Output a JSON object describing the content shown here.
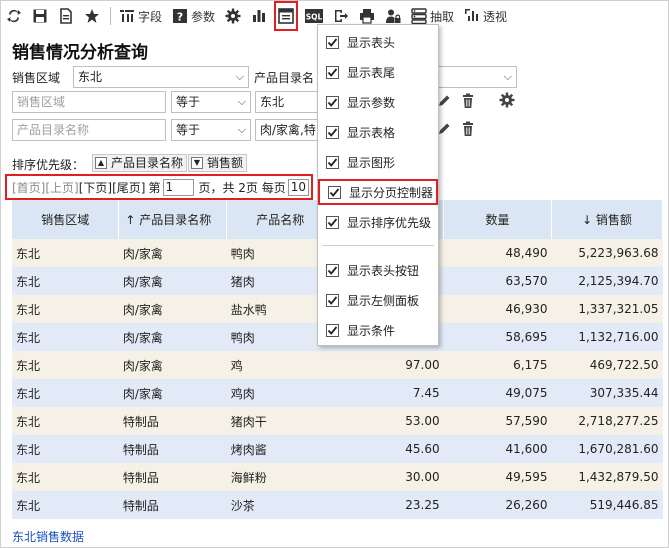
{
  "toolbar": {
    "items": [
      {
        "icon": "refresh-icon",
        "label": ""
      },
      {
        "icon": "save-icon",
        "label": ""
      },
      {
        "icon": "export-doc-icon",
        "label": ""
      },
      {
        "icon": "star-icon",
        "label": ""
      },
      {
        "icon": "fields-icon",
        "label": "字段"
      },
      {
        "icon": "param-icon",
        "label": "参数"
      },
      {
        "icon": "gear-icon",
        "label": ""
      },
      {
        "icon": "chart-icon",
        "label": ""
      },
      {
        "icon": "layout-icon",
        "label": ""
      },
      {
        "icon": "sql-icon",
        "label": "SQL"
      },
      {
        "icon": "exit-icon",
        "label": ""
      },
      {
        "icon": "print-icon",
        "label": ""
      },
      {
        "icon": "user-lock-icon",
        "label": ""
      },
      {
        "icon": "extract-icon",
        "label": "抽取"
      },
      {
        "icon": "pivot-icon",
        "label": "透视"
      }
    ]
  },
  "page_title": "销售情况分析查询",
  "filters": {
    "region_label": "销售区域",
    "region_value": "东北",
    "catalog_label": "产品目录名",
    "row1": {
      "field": "销售区域",
      "op": "等于",
      "value": "东北"
    },
    "row2": {
      "field": "产品目录名称",
      "op": "等于",
      "value": "肉/家禽,特"
    }
  },
  "sort": {
    "label": "排序优先级：",
    "chips": [
      {
        "arrow": "▲",
        "label": "产品目录名称"
      },
      {
        "arrow": "▼",
        "label": "销售额"
      }
    ]
  },
  "pager": {
    "first": "[首页]",
    "prev": "[上页]",
    "next": "[下页]",
    "last": "[尾页]",
    "page_prefix": "第",
    "page_value": "1",
    "page_suffix": "页，共 2页 每页",
    "size_value": "10"
  },
  "table": {
    "headers": [
      "销售区域",
      "↑ 产品目录名称",
      "产品名称",
      "",
      "数量",
      "↓ 销售额"
    ],
    "rows": [
      [
        "东北",
        "肉/家禽",
        "鸭肉",
        "",
        "48,490",
        "5,223,963.68"
      ],
      [
        "东北",
        "肉/家禽",
        "猪肉",
        "",
        "63,570",
        "2,125,394.70"
      ],
      [
        "东北",
        "肉/家禽",
        "盐水鸭",
        "",
        "46,930",
        "1,337,321.05"
      ],
      [
        "东北",
        "肉/家禽",
        "鸭肉",
        "",
        "58,695",
        "1,132,716.00"
      ],
      [
        "东北",
        "肉/家禽",
        "鸡",
        "97.00",
        "6,175",
        "469,722.50"
      ],
      [
        "东北",
        "肉/家禽",
        "鸡肉",
        "7.45",
        "49,075",
        "307,335.44"
      ],
      [
        "东北",
        "特制品",
        "猪肉干",
        "53.00",
        "57,590",
        "2,718,277.25"
      ],
      [
        "东北",
        "特制品",
        "烤肉酱",
        "45.60",
        "41,600",
        "1,670,281.60"
      ],
      [
        "东北",
        "特制品",
        "海鲜粉",
        "30.00",
        "49,595",
        "1,432,879.50"
      ],
      [
        "东北",
        "特制品",
        "沙茶",
        "23.25",
        "26,260",
        "519,446.85"
      ]
    ]
  },
  "footer_link": "东北销售数据",
  "menu": {
    "items": [
      "显示表头",
      "显示表尾",
      "显示参数",
      "显示表格",
      "显示图形",
      "显示分页控制器",
      "显示排序优先级",
      "显示表头按钮",
      "显示左侧面板",
      "显示条件"
    ]
  },
  "colors": {
    "header_bg": "#dbe6f4",
    "row_odd": "#f5f1e6",
    "row_even": "#e3eaf7",
    "highlight": "#e02020",
    "link": "#1a4fc4"
  }
}
